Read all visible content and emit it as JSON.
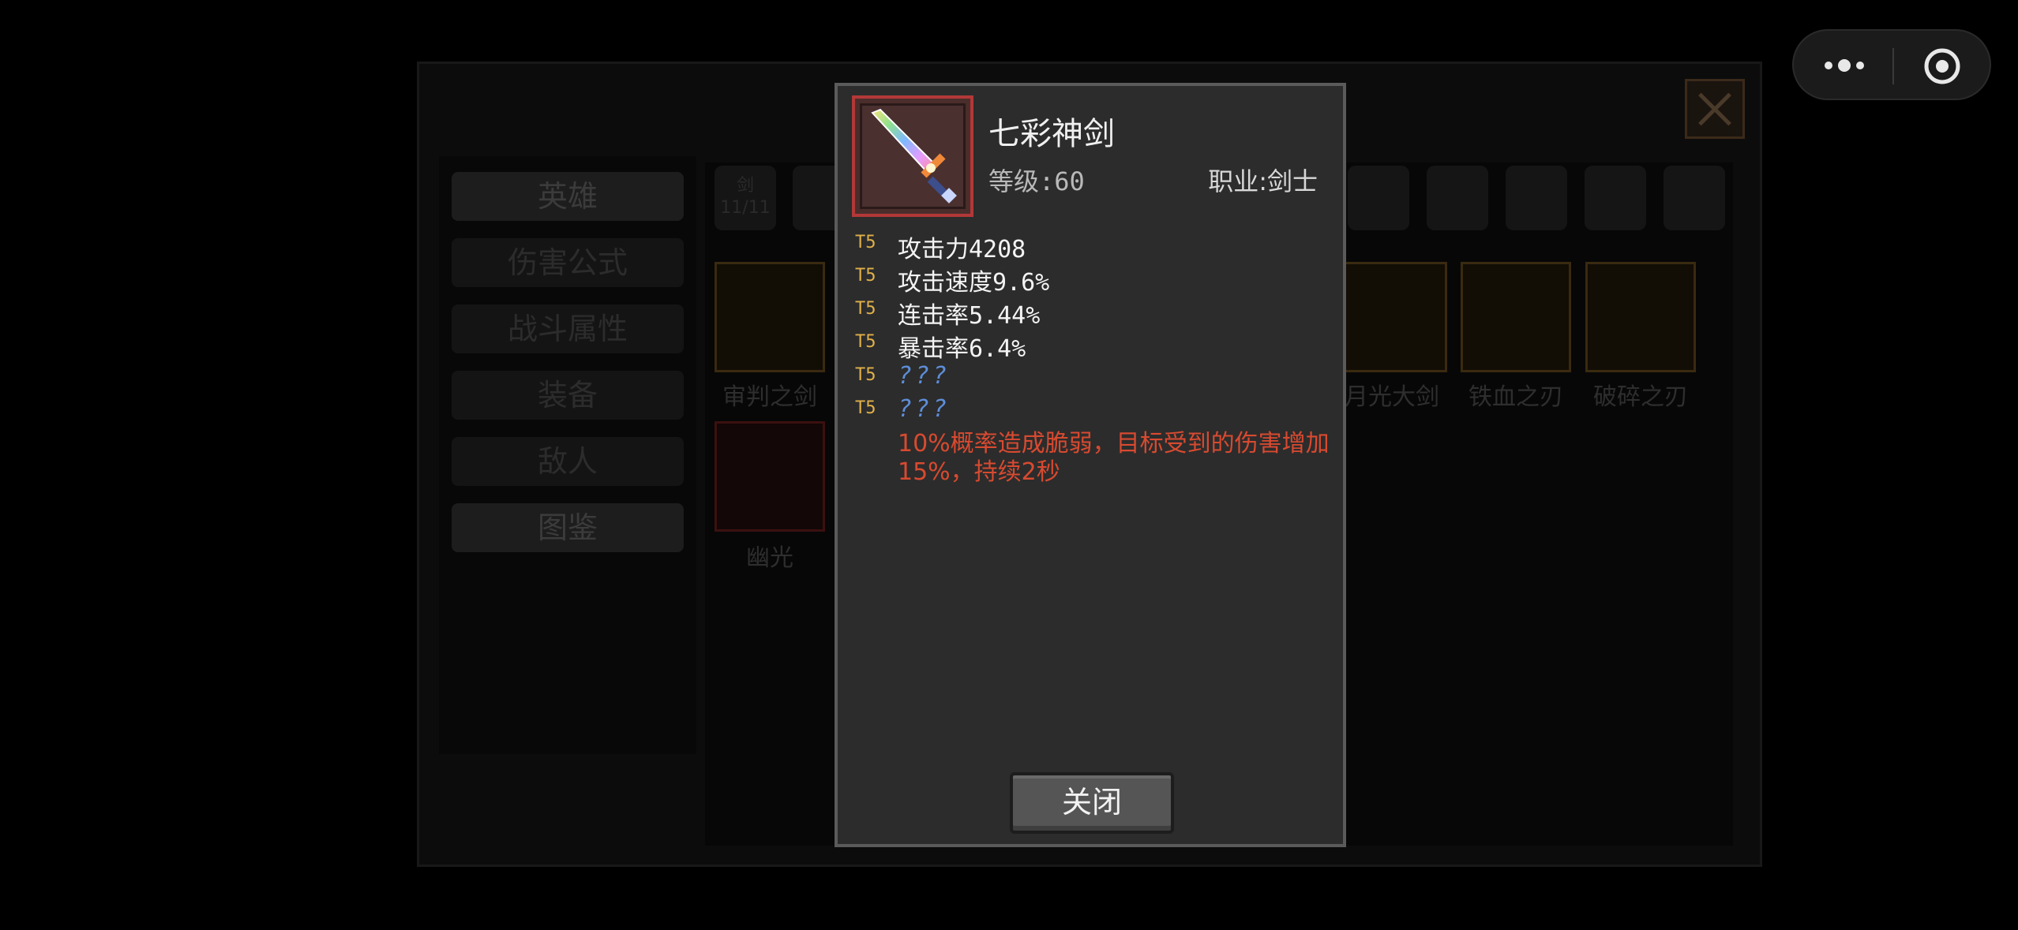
{
  "background": {
    "sidebar_tabs": [
      {
        "label": "英雄"
      },
      {
        "label": "伤害公式"
      },
      {
        "label": "战斗属性"
      },
      {
        "label": "装备"
      },
      {
        "label": "敌人"
      },
      {
        "label": "图鉴"
      }
    ],
    "categories": [
      {
        "label": "剑",
        "count": "11/11"
      }
    ],
    "items": [
      {
        "name": "审判之剑"
      },
      {
        "name": "月光大剑"
      },
      {
        "name": "铁血之刃"
      },
      {
        "name": "破碎之刃"
      },
      {
        "name": "幽光"
      }
    ]
  },
  "modal": {
    "item_name": "七彩神剑",
    "level_text": "等级:60",
    "class_text": "职业:剑士",
    "stats": [
      {
        "tier": "T5",
        "text": "攻击力4208",
        "unknown": false
      },
      {
        "tier": "T5",
        "text": "攻击速度9.6%",
        "unknown": false
      },
      {
        "tier": "T5",
        "text": "连击率5.44%",
        "unknown": false
      },
      {
        "tier": "T5",
        "text": "暴击率6.4%",
        "unknown": false
      },
      {
        "tier": "T5",
        "text": "???",
        "unknown": true
      },
      {
        "tier": "T5",
        "text": "???",
        "unknown": true
      }
    ],
    "effect_text": "10%概率造成脆弱，目标受到的伤害增加15%，持续2秒",
    "close_label": "关闭"
  },
  "capsule": {
    "more_icon": "more-dots-icon",
    "target_icon": "target-icon"
  },
  "colors": {
    "tier": "#e0b04a",
    "effect": "#d84a30",
    "unknown": "#5e8ed9",
    "modal_bg": "#2c2c2c",
    "item_frame": "#b33838"
  }
}
